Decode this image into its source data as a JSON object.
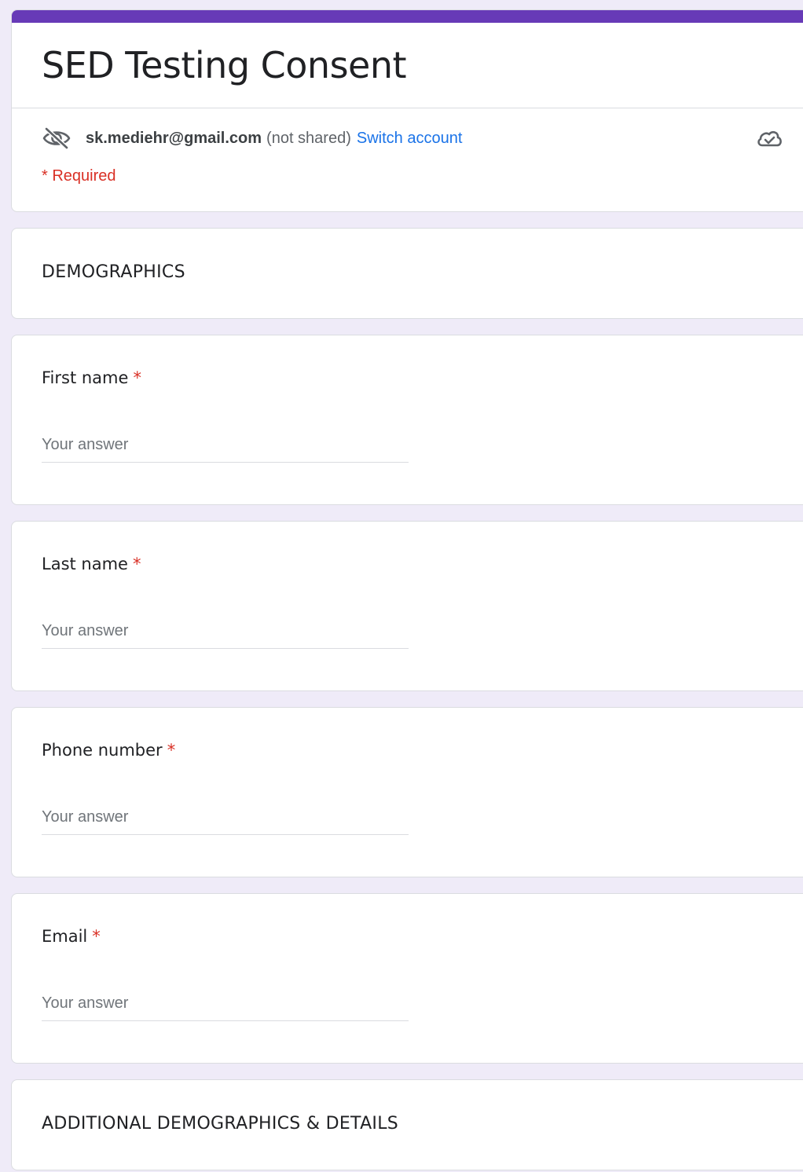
{
  "form": {
    "title": "SED Testing Consent",
    "account": {
      "email": "sk.mediehr@gmail.com",
      "not_shared": "(not shared)",
      "switch_label": "Switch account"
    },
    "required_note": "* Required"
  },
  "sections": [
    {
      "title": "DEMOGRAPHICS"
    },
    {
      "title": "ADDITIONAL DEMOGRAPHICS & DETAILS"
    }
  ],
  "questions": [
    {
      "label": "First name",
      "required_mark": "*",
      "placeholder": "Your answer"
    },
    {
      "label": "Last name",
      "required_mark": "*",
      "placeholder": "Your answer"
    },
    {
      "label": "Phone number",
      "required_mark": "*",
      "placeholder": "Your answer"
    },
    {
      "label": "Email",
      "required_mark": "*",
      "placeholder": "Your answer"
    }
  ],
  "colors": {
    "accent": "#673ab7",
    "background": "#efebf8",
    "required": "#d93025",
    "link": "#1a73e8"
  },
  "icons": {
    "visibility": "eye-off-icon",
    "saved": "cloud-check-icon"
  }
}
